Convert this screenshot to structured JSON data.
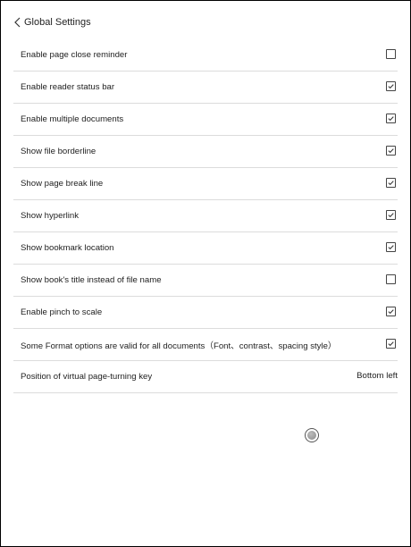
{
  "header": {
    "back_icon": "chevron-left-icon",
    "title": "Global Settings"
  },
  "settings": [
    {
      "label": "Enable page close reminder",
      "checked": false
    },
    {
      "label": "Enable reader status bar",
      "checked": true
    },
    {
      "label": "Enable multiple documents",
      "checked": true
    },
    {
      "label": "Show file borderline",
      "checked": true
    },
    {
      "label": "Show page break line",
      "checked": true
    },
    {
      "label": "Show hyperlink",
      "checked": true
    },
    {
      "label": "Show bookmark location",
      "checked": true
    },
    {
      "label": "Show book's title instead of file name",
      "checked": false
    },
    {
      "label": "Enable pinch to scale",
      "checked": true
    },
    {
      "label": "Some Format options are valid for all documents（Font、contrast、spacing style）",
      "checked": true
    }
  ],
  "virtual_key": {
    "label": "Position of virtual page-turning key",
    "value": "Bottom left"
  },
  "floating_button": {
    "icon": "floating-ball-icon"
  },
  "colors": {
    "text": "#222222",
    "divider": "#dcdcdc",
    "border": "#000000"
  }
}
